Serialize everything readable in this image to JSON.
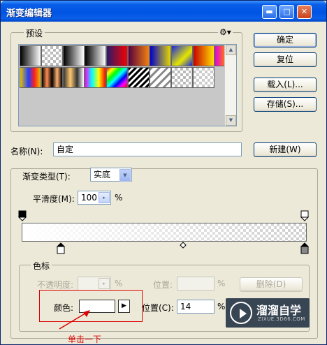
{
  "window": {
    "title": "渐变编辑器"
  },
  "titlebar_buttons": {
    "minimize": "▬",
    "maximize": "□",
    "close": "✕"
  },
  "presets": {
    "label": "预设",
    "menu_icon": "gear-icon",
    "scroll_up": "▲",
    "scroll_down": "▼",
    "swatches": [
      "linear-gradient(to right,#000,#fff)",
      "repeating-conic-gradient(#bbb 0% 25%,#fff 0% 50%) 0 0/8px 8px",
      "linear-gradient(to right,#000,#fff)",
      "linear-gradient(to right,#000,#fff)",
      "linear-gradient(to right,#2a1b6b,#f50000)",
      "linear-gradient(to right,#5a003f,#f08010)",
      "linear-gradient(to right,#0000c8,#e6d800)",
      "linear-gradient(135deg,#1a2ae0,#e6e600 60%,#1a2ae0)",
      "linear-gradient(to right,#c80000,#ffe000)",
      "linear-gradient(to right,#e600e6,#ff8000 50%,#00c800)",
      "linear-gradient(to right,#e6c200,#2040ff 40%,#ff2020 70%,#e6c200)",
      "linear-gradient(to right,#000,#ff8c50,#000,#ffb070,#000)",
      "linear-gradient(to right,#333,#ffc870,#333,#fff)",
      "linear-gradient(to right,#ff00ff,#00ffff,#ffff00,#ff0000)",
      "linear-gradient(135deg,#f00,#ff0,#0f0,#0ff,#00f,#f0f,#f00)",
      "repeating-linear-gradient(135deg,#000 0 3px,#fff 3px 6px)",
      "repeating-linear-gradient(135deg,#888 0 3px,#fff 3px 8px)",
      "repeating-conic-gradient(#bbb 0% 25%,#fff 0% 50%) 0 0/8px 8px",
      "repeating-conic-gradient(#ccc 0% 25%,#fff 0% 50%) 0 0/8px 8px"
    ]
  },
  "buttons": {
    "ok": "确定",
    "reset": "复位",
    "load": "载入(L)...",
    "save": "存储(S)...",
    "new": "新建(W)"
  },
  "name": {
    "label": "名称(N):",
    "value": "自定"
  },
  "gradient_type": {
    "label": "渐变类型(T):",
    "value": "实底"
  },
  "smoothness": {
    "label": "平滑度(M):",
    "value": "100",
    "unit": "%"
  },
  "color_stops": {
    "label": "色标",
    "opacity_label": "不透明度:",
    "opacity_unit": "%",
    "opacity_location_label": "位置:",
    "opacity_location_unit": "%",
    "delete_label": "删除(D)",
    "color_label": "颜色:",
    "color_value": "#ffffff",
    "color_location_label": "位置(C):",
    "color_location_value": "14",
    "color_location_unit": "%"
  },
  "annotation": "单击一下",
  "watermark": {
    "title": "溜溜自学",
    "url": "ZIXUE.3D66.COM"
  }
}
